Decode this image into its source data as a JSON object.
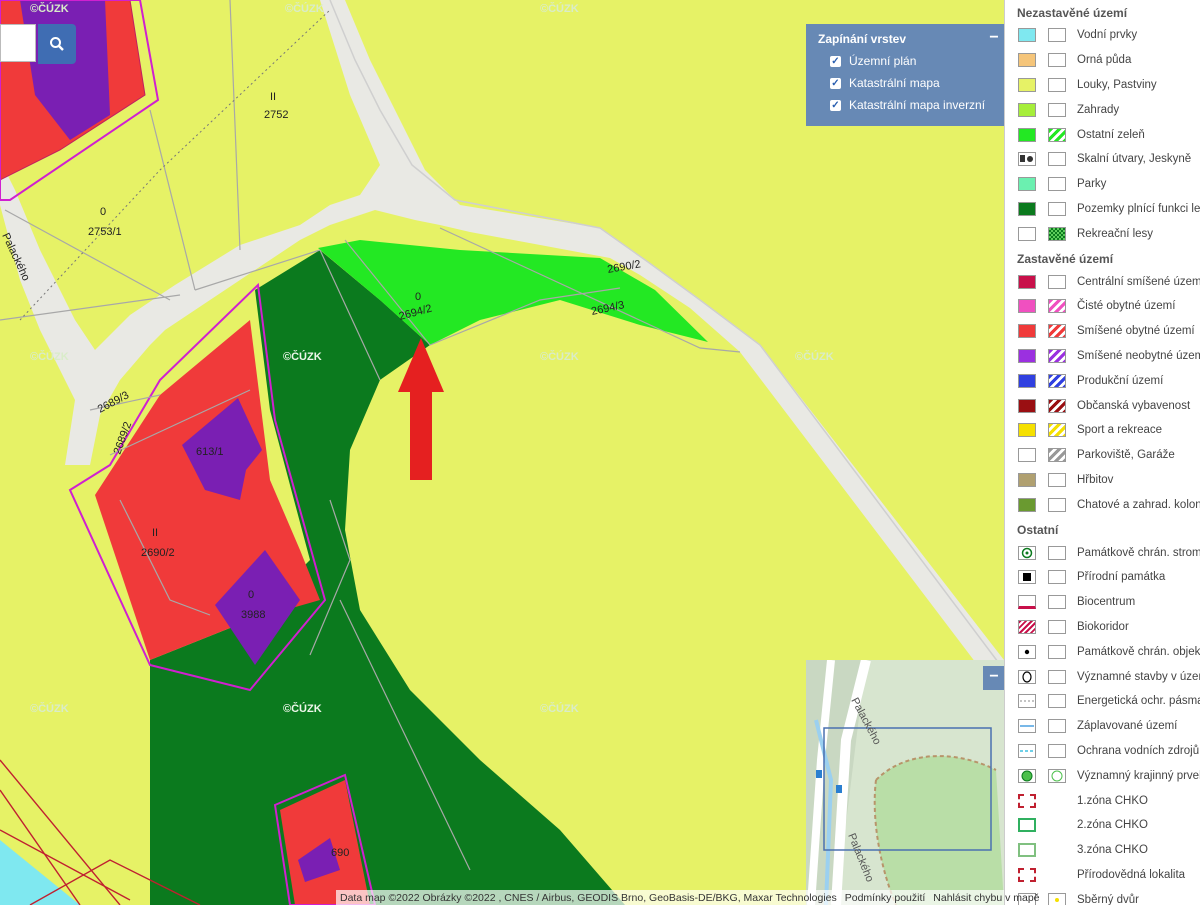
{
  "map": {
    "parcels": [
      "2752",
      "2753/1",
      "2690/2",
      "2694/2",
      "2694/3",
      "2689/3",
      "613/1",
      "2690/2",
      "3988",
      "690",
      "2689/2"
    ],
    "land_use_codes": [
      "II",
      "0",
      "0",
      "II",
      "0"
    ],
    "street_name": "Palackého",
    "watermark": "©ČÚZK"
  },
  "layer_switcher": {
    "title": "Zapínání vrstev",
    "collapse_symbol": "−",
    "layers": [
      {
        "label": "Územní plán",
        "checked": true
      },
      {
        "label": "Katastrální mapa",
        "checked": true
      },
      {
        "label": "Katastrální mapa inverzní",
        "checked": true
      }
    ]
  },
  "minimap": {
    "collapse_symbol": "−",
    "street_labels": [
      "Palackého",
      "Palackého"
    ]
  },
  "legend": {
    "sections": [
      {
        "title": "Nezastavěné území",
        "items": [
          {
            "label": "Vodní prvky",
            "color": "#7fe8f0"
          },
          {
            "label": "Orná půda",
            "color": "#f5c57a"
          },
          {
            "label": "Louky, Pastviny",
            "color": "#e6f266"
          },
          {
            "label": "Zahrady",
            "color": "#a6ee3a"
          },
          {
            "label": "Ostatní zeleň",
            "color": "#23e823",
            "alt_pattern": "green-hatch"
          },
          {
            "label": "Skalní útvary, Jeskyně",
            "color": "#ffffff",
            "icon": "rock-icon"
          },
          {
            "label": "Parky",
            "color": "#6bf0b0"
          },
          {
            "label": "Pozemky plnící funkci lesa",
            "color": "#0b7a1e"
          },
          {
            "label": "Rekreační lesy",
            "color": "#ffffff",
            "alt_pattern": "dark-green-check"
          }
        ]
      },
      {
        "title": "Zastavěné území",
        "items": [
          {
            "label": "Centrální smíšené území",
            "color": "#c8104a"
          },
          {
            "label": "Čisté obytné území",
            "color": "#f050c0",
            "alt_pattern": "pink-hatch"
          },
          {
            "label": "Smíšené obytné území",
            "color": "#f03a3a",
            "alt_pattern": "red-hatch"
          },
          {
            "label": "Smíšené neobytné území",
            "color": "#9b30e0",
            "alt_pattern": "purple-hatch"
          },
          {
            "label": "Produkční území",
            "color": "#3040e0",
            "alt_pattern": "blue-hatch"
          },
          {
            "label": "Občanská vybavenost",
            "color": "#9a0f12",
            "alt_pattern": "darkred-hatch"
          },
          {
            "label": "Sport a rekreace",
            "color": "#f5e000",
            "alt_pattern": "yellow-hatch"
          },
          {
            "label": "Parkoviště, Garáže",
            "color": "#ffffff",
            "alt_pattern": "grey-hatch"
          },
          {
            "label": "Hřbitov",
            "color": "#b0a070"
          },
          {
            "label": "Chatové a zahrad. kolonie",
            "color": "#6a9a30"
          }
        ]
      },
      {
        "title": "Ostatní",
        "items": [
          {
            "label": "Památkově chrán. strom",
            "icon": "tree-icon"
          },
          {
            "label": "Přírodní památka",
            "icon": "square-black-icon"
          },
          {
            "label": "Biocentrum",
            "icon": "biocentrum-icon"
          },
          {
            "label": "Biokoridor",
            "icon": "biokoridor-icon"
          },
          {
            "label": "Památkově chrán. objekty",
            "icon": "dot-icon"
          },
          {
            "label": "Významné stavby v území",
            "icon": "oval-icon"
          },
          {
            "label": "Energetická ochr. pásma",
            "icon": "dashed-line-icon"
          },
          {
            "label": "Záplavované území",
            "icon": "flood-icon"
          },
          {
            "label": "Ochrana vodních zdrojů",
            "icon": "water-protection-icon"
          },
          {
            "label": "Významný krajinný prvek",
            "icon": "landscape-icon"
          },
          {
            "label": "1.zóna CHKO",
            "icon": "zone1-icon"
          },
          {
            "label": "2.zóna CHKO",
            "icon": "zone2-icon"
          },
          {
            "label": "3.zóna CHKO",
            "icon": "zone3-icon"
          },
          {
            "label": "Přírodovědná lokalita",
            "icon": "locality-icon"
          },
          {
            "label": "Sběrný dvůr",
            "icon": "collection-icon"
          }
        ]
      }
    ]
  },
  "attribution": {
    "data": "Data map ©2022 Obrázky ©2022 , CNES / Airbus, GEODIS Brno, GeoBasis-DE/BKG, Maxar Technologies",
    "terms": "Podmínky použití",
    "report": "Nahlásit chybu v mapě"
  }
}
